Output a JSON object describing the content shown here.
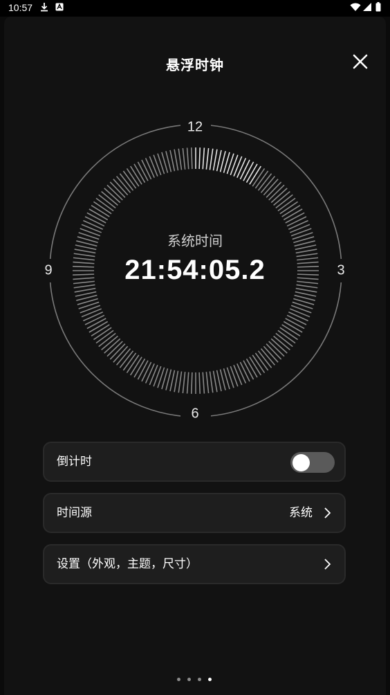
{
  "status_bar": {
    "time": "10:57"
  },
  "header": {
    "title": "悬浮时钟"
  },
  "clock": {
    "dial_numbers": {
      "top": "12",
      "right": "3",
      "bottom": "6",
      "left": "9"
    },
    "label": "系统时间",
    "time": "21:54:05.2",
    "seconds_progress": 0.09
  },
  "settings": {
    "countdown": {
      "label": "倒计时",
      "enabled": false
    },
    "time_source": {
      "label": "时间源",
      "value": "系统"
    },
    "preferences": {
      "label": "设置（外观，主题，尺寸）"
    }
  },
  "pager": {
    "count": 4,
    "active_index": 3
  }
}
